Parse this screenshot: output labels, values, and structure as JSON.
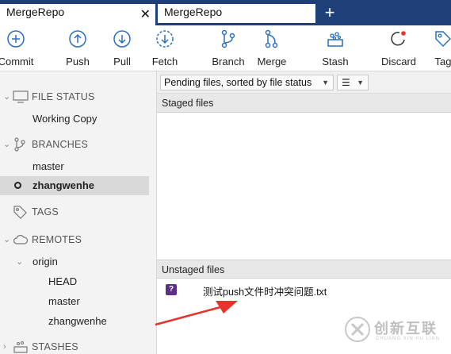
{
  "tabs": [
    {
      "label": "MergeRepo",
      "close": "✕"
    },
    {
      "label": "MergeRepo"
    }
  ],
  "tab_add": "+",
  "toolbar": {
    "commit": "Commit",
    "push": "Push",
    "pull": "Pull",
    "fetch": "Fetch",
    "branch": "Branch",
    "merge": "Merge",
    "stash": "Stash",
    "discard": "Discard",
    "tag": "Tag"
  },
  "sidebar": {
    "file_status": "FILE STATUS",
    "working_copy": "Working Copy",
    "branches": "BRANCHES",
    "branch_items": [
      "master",
      "zhangwenhe"
    ],
    "tags": "TAGS",
    "remotes": "REMOTES",
    "remote_origin": "origin",
    "remote_items": [
      "HEAD",
      "master",
      "zhangwenhe"
    ],
    "stashes": "STASHES"
  },
  "main": {
    "sort_dropdown": "Pending files, sorted by file status",
    "staged_header": "Staged files",
    "unstaged_header": "Unstaged files",
    "unstaged_files": [
      {
        "status": "?",
        "name": "测试push文件时冲突问题.txt"
      }
    ]
  },
  "watermark": {
    "text": "创新互联",
    "sub": "CHUANG XIN HU LIAN"
  },
  "colors": {
    "tabbar": "#1f3f78",
    "accent_icon": "#2a6fc0",
    "badge_untracked": "#5a2f85",
    "arrow": "#e8332a"
  }
}
